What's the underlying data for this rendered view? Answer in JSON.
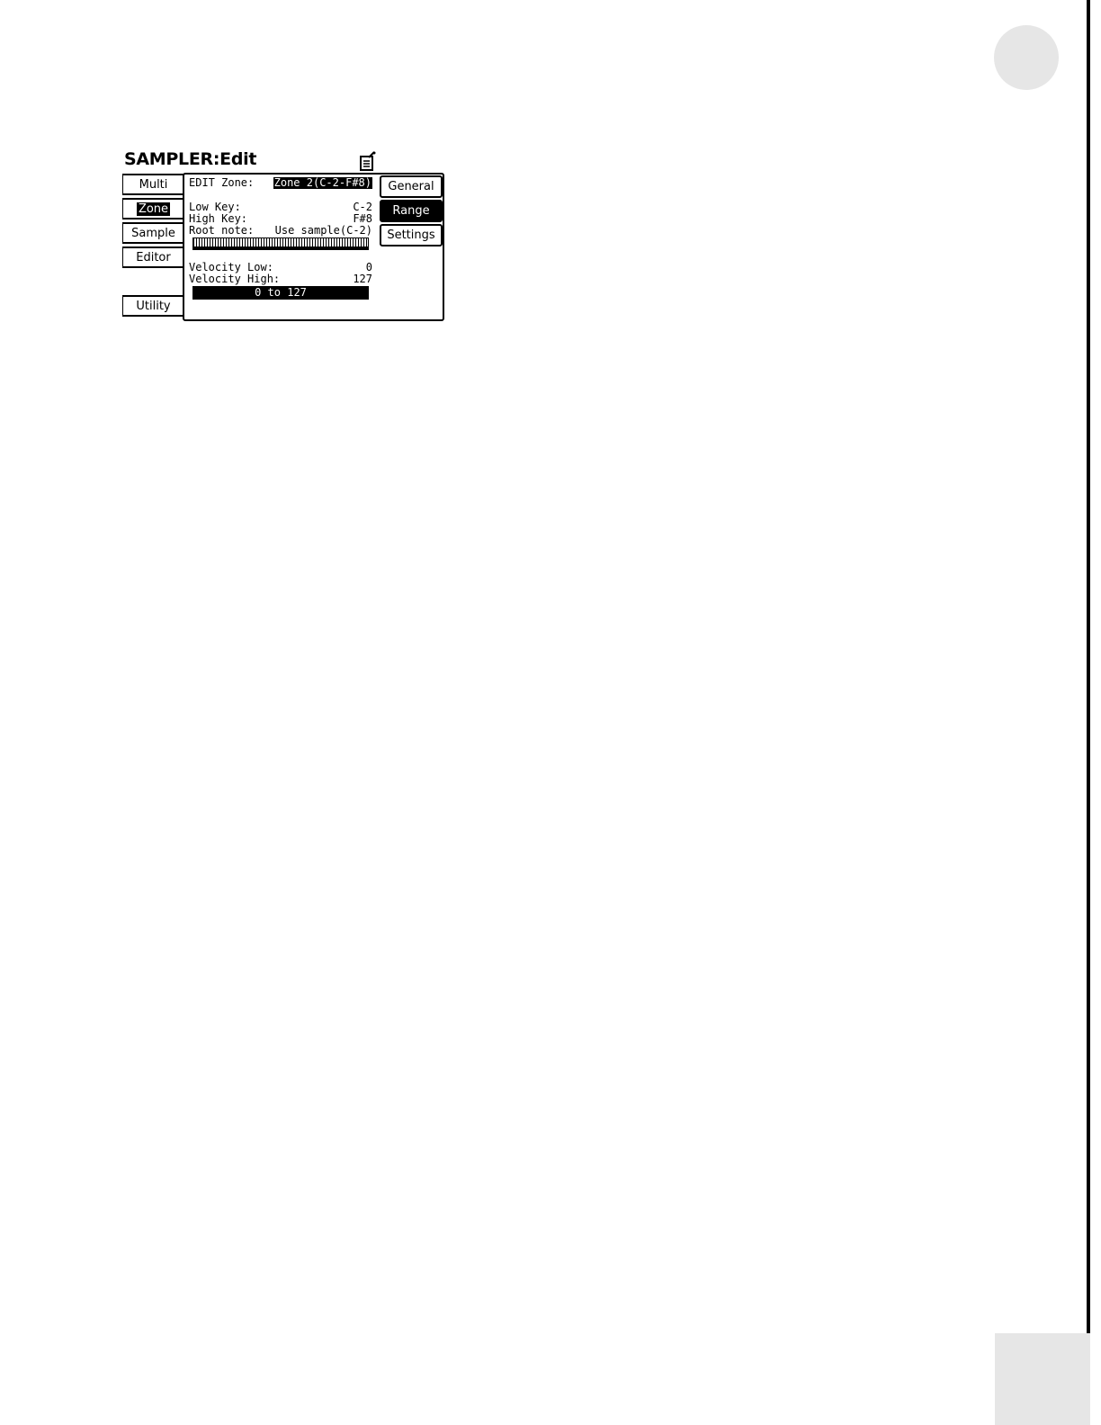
{
  "screen": {
    "title": "SAMPLER:Edit",
    "side_tabs": [
      {
        "label": "Multi",
        "active": false
      },
      {
        "label": "Zone",
        "active": true
      },
      {
        "label": "Sample",
        "active": false
      },
      {
        "label": "Editor",
        "active": false
      },
      {
        "label": "Utility",
        "active": false
      }
    ],
    "right_buttons": [
      {
        "label": "General",
        "active": false
      },
      {
        "label": "Range",
        "active": true
      },
      {
        "label": "Settings",
        "active": false
      }
    ],
    "edit_zone": {
      "label": "EDIT Zone:",
      "value": "Zone 2(C-2-F#8)"
    },
    "low_key": {
      "label": "Low Key:",
      "value": "C-2"
    },
    "high_key": {
      "label": "High Key:",
      "value": "F#8"
    },
    "root_note": {
      "label": "Root note:",
      "value": "Use sample(C-2)"
    },
    "velocity_low": {
      "label": "Velocity Low:",
      "value": "0"
    },
    "velocity_high": {
      "label": "Velocity High:",
      "value": "127"
    },
    "velocity_range": "0 to 127"
  }
}
